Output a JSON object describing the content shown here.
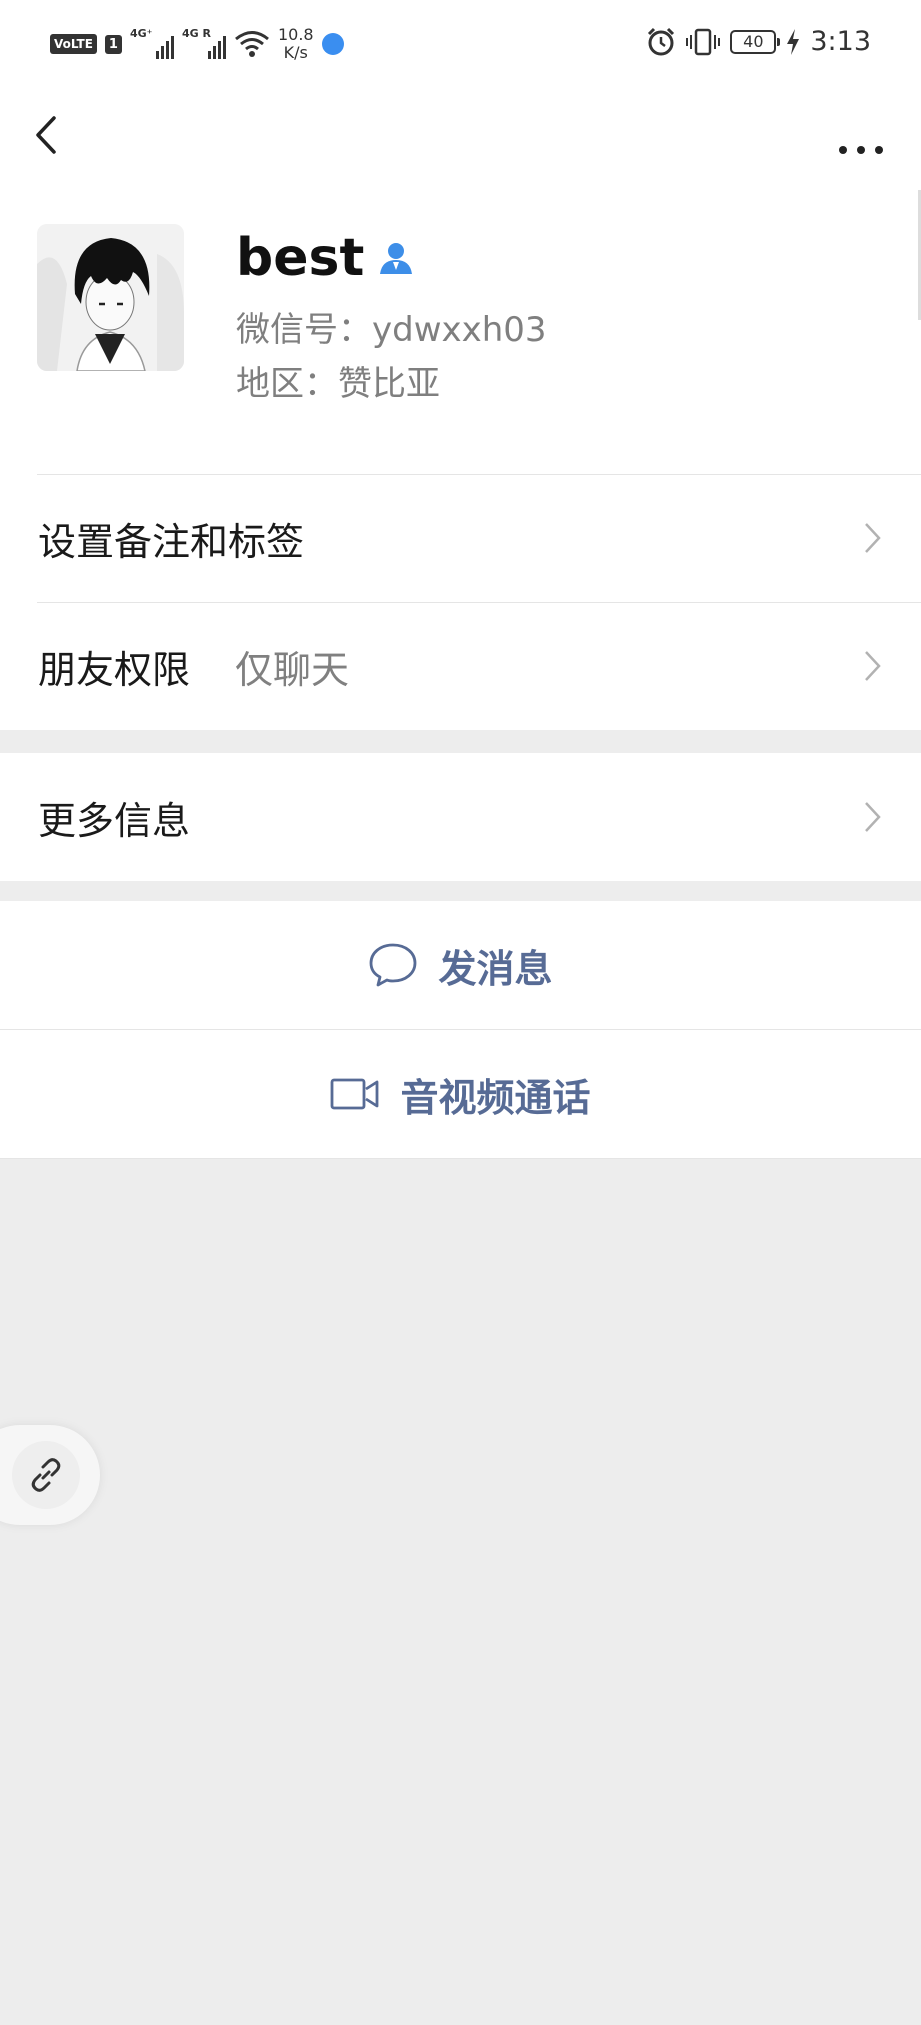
{
  "status_bar": {
    "volte": "VoLTE",
    "sim": "1",
    "net1": "4G⁺",
    "net2": "4G R",
    "speed_value": "10.8",
    "speed_unit": "K/s",
    "battery": "40",
    "time": "3:13"
  },
  "profile": {
    "name": "best",
    "wechat_id": "微信号：ydwxxh03",
    "region": "地区：赞比亚"
  },
  "menu": {
    "remark_label": "设置备注和标签",
    "permission_label": "朋友权限",
    "permission_value": "仅聊天",
    "more_info_label": "更多信息"
  },
  "actions": {
    "message_label": "发消息",
    "call_label": "音视频通话"
  },
  "colors": {
    "link_blue": "#576b95",
    "background": "#ededed",
    "contact_badge": "#3d8ee8"
  },
  "icons": [
    "back-arrow-icon",
    "more-dots-icon",
    "contact-person-icon",
    "chevron-right-icon",
    "chat-bubble-icon",
    "video-camera-icon",
    "link-icon"
  ]
}
